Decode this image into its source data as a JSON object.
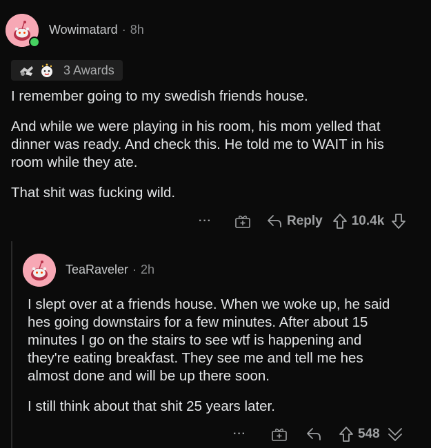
{
  "comment1": {
    "username": "Wowimatard",
    "separator": "·",
    "age": "8h",
    "awards_label": "3 Awards",
    "paragraphs": [
      "I remember going to my swedish friends house.",
      "And while we were playing in his room, his mom yelled that dinner was ready. And check this. He told me to WAIT in his room while they ate.",
      "That shit was fucking wild."
    ],
    "more_label": "···",
    "reply_label": "Reply",
    "vote_count": "10.4k"
  },
  "comment2": {
    "username": "TeaRaveler",
    "separator": "·",
    "age": "2h",
    "paragraphs": [
      "I slept over at a friends house. When we woke up, he said hes going downstairs for a few minutes. After about 15 minutes I go on the stairs to see wtf is happening and they're eating breakfast. They see me and tell me hes almost done and will be up there soon.",
      "I still think about that shit 25 years later."
    ],
    "more_label": "···",
    "vote_count": "548"
  },
  "colors": {
    "background": "#0b0b0b",
    "text": "#e2e4e6",
    "muted": "#8a8c8e",
    "avatar": "#f7a8b5",
    "online": "#46d160"
  }
}
